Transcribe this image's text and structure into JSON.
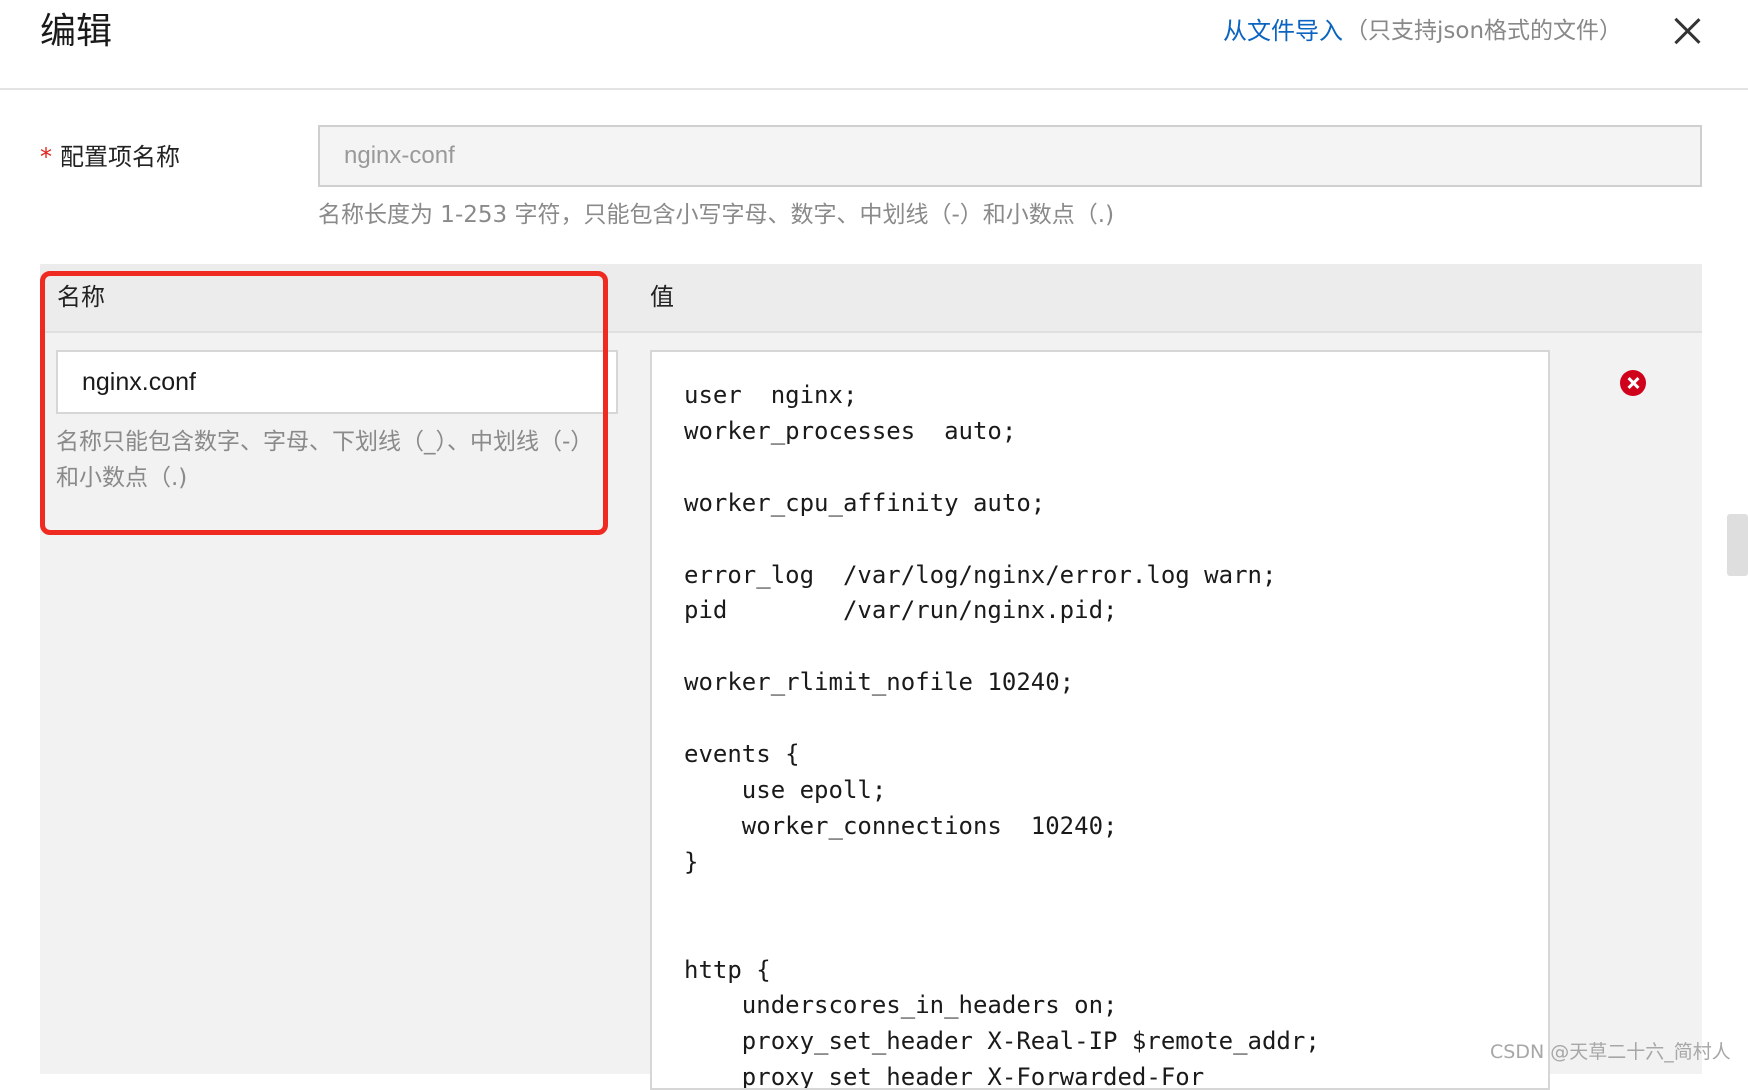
{
  "dialog": {
    "title": "编辑",
    "import_link": "从文件导入",
    "import_hint": "（只支持json格式的文件）"
  },
  "form": {
    "name_label": "配置项名称",
    "required_mark": "*",
    "name_value": "nginx-conf",
    "name_help": "名称长度为 1-253 字符，只能包含小写字母、数字、中划线（-）和小数点（.)"
  },
  "table": {
    "col_name": "名称",
    "col_value": "值",
    "row": {
      "key": "nginx.conf",
      "key_help": "名称只能包含数字、字母、下划线（_）、中划线（-）和小数点（.)",
      "value": "user  nginx;\nworker_processes  auto;\n\nworker_cpu_affinity auto;\n\nerror_log  /var/log/nginx/error.log warn;\npid        /var/run/nginx.pid;\n\nworker_rlimit_nofile 10240;\n\nevents {\n    use epoll;\n    worker_connections  10240;\n}\n\n\nhttp {\n    underscores_in_headers on;\n    proxy_set_header X-Real-IP $remote_addr;\n    proxy_set_header X-Forwarded-For"
    }
  },
  "watermark": "CSDN @天草二十六_简村人",
  "colors": {
    "link": "#0b64c0",
    "highlight": "#ef2a21",
    "remove": "#d0021b"
  }
}
